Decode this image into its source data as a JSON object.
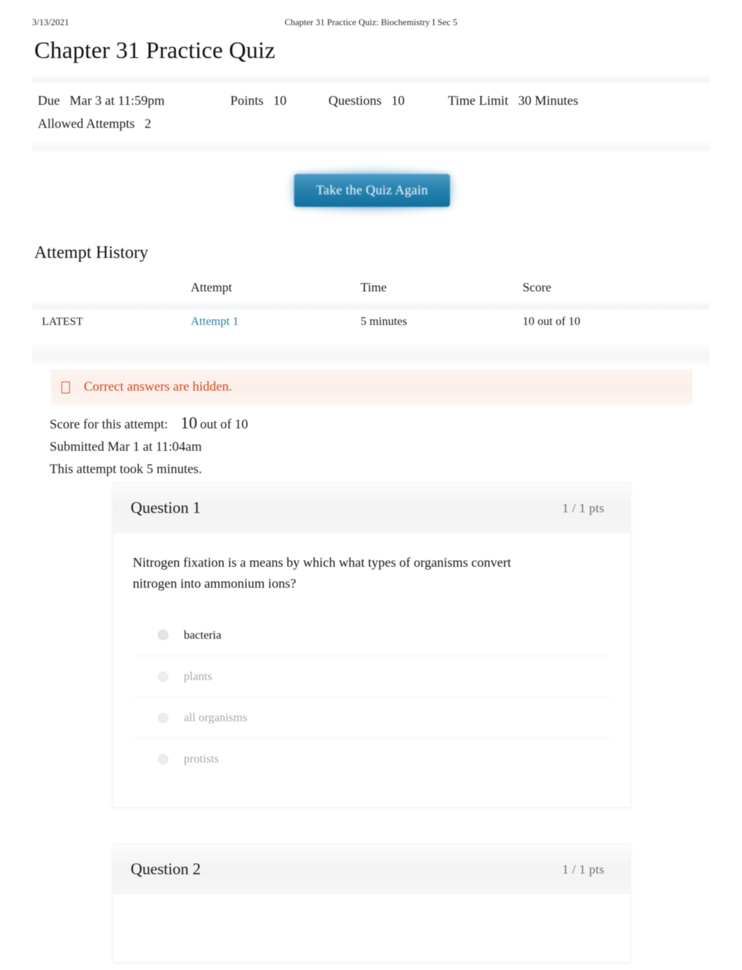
{
  "print_header": {
    "date": "3/13/2021",
    "document_title": "Chapter 31 Practice Quiz: Biochemistry I Sec 5"
  },
  "page_title": "Chapter 31 Practice Quiz",
  "quiz_details": [
    {
      "label": "Due",
      "value": "Mar 3 at 11:59pm"
    },
    {
      "label": "Points",
      "value": "10"
    },
    {
      "label": "Questions",
      "value": "10"
    },
    {
      "label": "Time Limit",
      "value": "30 Minutes"
    },
    {
      "label": "Allowed Attempts",
      "value": "2"
    }
  ],
  "actions": {
    "take_quiz_again": "Take the Quiz Again"
  },
  "attempt_history": {
    "heading": "Attempt History",
    "columns": [
      "",
      "Attempt",
      "Time",
      "Score"
    ],
    "rows": [
      {
        "flag": "LATEST",
        "attempt": "Attempt 1",
        "time": "5 minutes",
        "score": "10 out of 10"
      }
    ]
  },
  "notice": {
    "icon": "warning-box-icon",
    "text": "Correct answers are hidden.",
    "color": "#cf4a20",
    "background": "#fcefe9"
  },
  "attempt_summary": {
    "score_label": "Score for this attempt:",
    "score_value": "10",
    "score_suffix": "out of 10",
    "submitted": "Submitted Mar 1 at 11:04am",
    "duration": "This attempt took 5 minutes."
  },
  "questions": [
    {
      "title": "Question 1",
      "points": "1 / 1 pts",
      "text": "Nitrogen fixation is a means by which what types of organisms convert nitrogen into ammonium ions?",
      "answers": [
        {
          "label": "bacteria",
          "selected": true
        },
        {
          "label": "plants",
          "selected": false
        },
        {
          "label": "all organisms",
          "selected": false
        },
        {
          "label": "protists",
          "selected": false
        }
      ]
    },
    {
      "title": "Question 2",
      "points": "1 / 1 pts",
      "text": "",
      "answers": []
    }
  ],
  "theme": {
    "link_color": "#2a7ca3",
    "button_gradient_top": "#4d9cc6",
    "button_gradient_bottom": "#11709f",
    "notice_text_color": "#cf4a20",
    "muted_text_color": "#a8a8a8"
  }
}
